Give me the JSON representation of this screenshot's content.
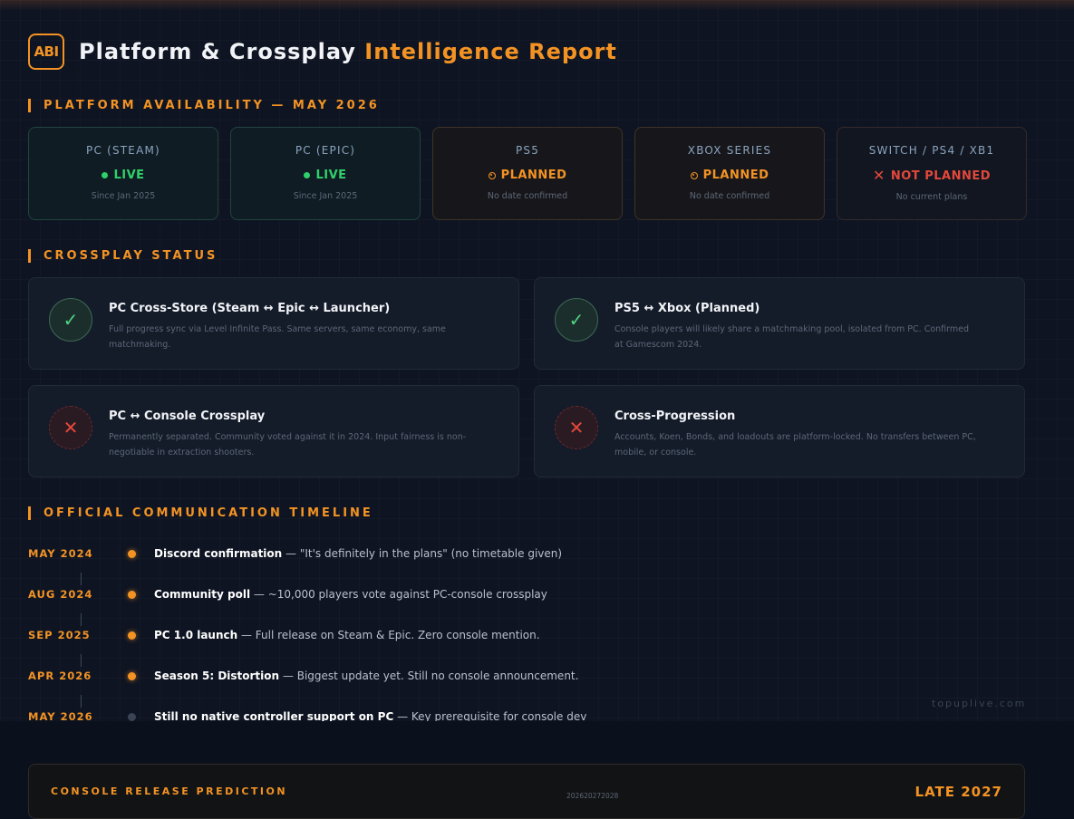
{
  "header": {
    "logo_text": "ABI",
    "title_main": "Platform & Crossplay",
    "title_accent": "Intelligence Report"
  },
  "sections": {
    "availability": "PLATFORM AVAILABILITY — MAY 2026",
    "crossplay": "CROSSPLAY STATUS",
    "timeline": "OFFICIAL COMMUNICATION TIMELINE"
  },
  "platforms": [
    {
      "name": "PC (STEAM)",
      "status": "LIVE",
      "sub": "Since Jan 2025",
      "kind": "live"
    },
    {
      "name": "PC (EPIC)",
      "status": "LIVE",
      "sub": "Since Jan 2025",
      "kind": "live"
    },
    {
      "name": "PS5",
      "status": "PLANNED",
      "sub": "No date confirmed",
      "kind": "planned"
    },
    {
      "name": "XBOX SERIES",
      "status": "PLANNED",
      "sub": "No date confirmed",
      "kind": "planned"
    },
    {
      "name": "SWITCH / PS4 / XB1",
      "status": "NOT PLANNED",
      "sub": "No current plans",
      "kind": "no"
    }
  ],
  "crossplay": [
    {
      "title": "PC Cross-Store (Steam ↔ Epic ↔ Launcher)",
      "desc": "Full progress sync via Level Infinite Pass. Same servers, same economy, same matchmaking.",
      "ok": true
    },
    {
      "title": "PS5 ↔ Xbox (Planned)",
      "desc": "Console players will likely share a matchmaking pool, isolated from PC. Confirmed at Gamescom 2024.",
      "ok": true
    },
    {
      "title": "PC ↔ Console Crossplay",
      "desc": "Permanently separated. Community voted against it in 2024. Input fairness is non-negotiable in extraction shooters.",
      "ok": false
    },
    {
      "title": "Cross-Progression",
      "desc": "Accounts, Koen, Bonds, and loadouts are platform-locked. No transfers between PC, mobile, or console.",
      "ok": false
    }
  ],
  "timeline": [
    {
      "date": "MAY 2024",
      "bold": "Discord confirmation",
      "rest": " — \"It's definitely in the plans\" (no timetable given)",
      "active": true
    },
    {
      "date": "AUG 2024",
      "bold": "Community poll",
      "rest": " — ~10,000 players vote against PC-console crossplay",
      "active": true
    },
    {
      "date": "SEP 2025",
      "bold": "PC 1.0 launch",
      "rest": " — Full release on Steam & Epic. Zero console mention.",
      "active": true
    },
    {
      "date": "APR 2026",
      "bold": "Season 5: Distortion",
      "rest": " — Biggest update yet. Still no console announcement.",
      "active": true
    },
    {
      "date": "MAY 2026",
      "bold": "Still no native controller support on PC",
      "rest": " — Key prerequisite for console dev",
      "active": false
    }
  ],
  "watermark": "topuplive.com",
  "prediction": {
    "label": "CONSOLE RELEASE PREDICTION",
    "years": "202620272028",
    "value": "LATE 2027"
  },
  "colors": {
    "accent": "#f39324",
    "live": "#2fd26a",
    "bad": "#e4483b",
    "bg": "#0e1422"
  }
}
